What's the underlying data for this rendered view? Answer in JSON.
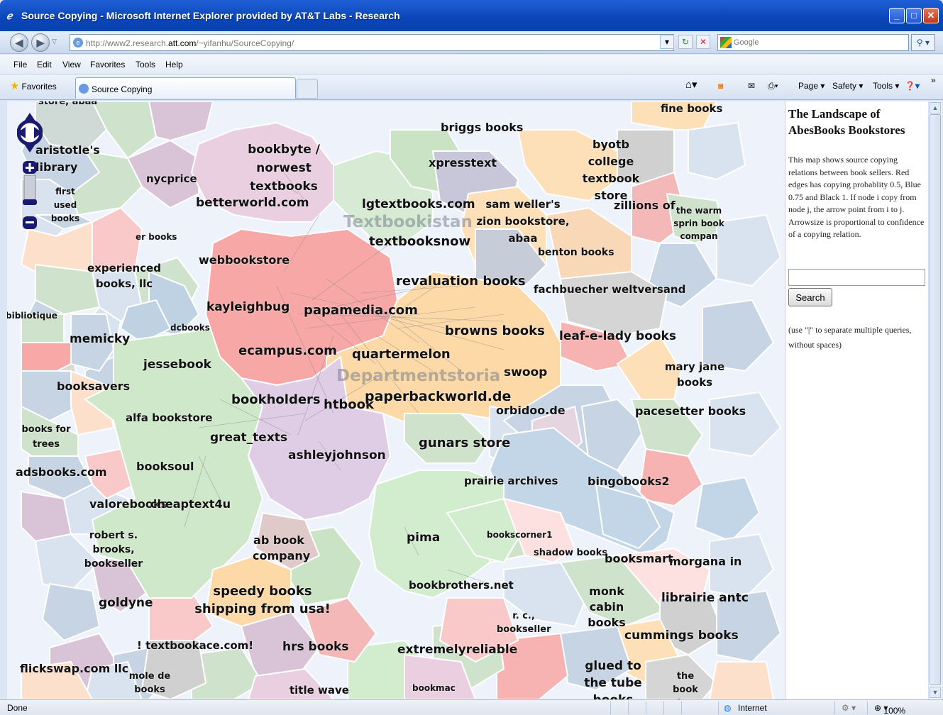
{
  "window": {
    "title": "Source Copying - Microsoft Internet Explorer provided by AT&T Labs - Research"
  },
  "nav": {
    "url_prefix": "http://www2.research.",
    "url_domain": "att.com",
    "url_rest": "/~yifanhu/SourceCopying/",
    "search_placeholder": "Google"
  },
  "menu": {
    "items": [
      "File",
      "Edit",
      "View",
      "Favorites",
      "Tools",
      "Help"
    ]
  },
  "favorites": {
    "favorites_label": "Favorites",
    "tab_label": "Source Copying"
  },
  "commandbar": {
    "page": "Page",
    "safety": "Safety",
    "tools": "Tools"
  },
  "panel": {
    "title": "The Landscape of AbesBooks Bookstores",
    "description": "This map shows source copying relations between book sellers. Red edges has copying probablity 0.5, Blue 0.75 and Black 1. If node i copy from node j, the arrow point from i to j. Arrowsize is proportional to confidence of a copying relation.",
    "search_value": "",
    "search_button": "Search",
    "hint": "(use \"|\" to separate multiple queries, without spaces)"
  },
  "status": {
    "left": "Done",
    "zone": "Internet",
    "zoom": "100%"
  },
  "map": {
    "regions": [
      {
        "name": "Textbookistan",
        "color": "#c9c9c9"
      },
      {
        "name": "Departmentstoria",
        "color": "#c9c9c9"
      }
    ],
    "labels": [
      "store, abaa",
      "fine books",
      "briggs books",
      "aristotle's library",
      "bookbyte / norwest textbooks",
      "byotb college textbook store",
      "xpresstext",
      "nycprice",
      "first used books",
      "betterworld.com",
      "lgtextbooks.com",
      "sam weller's zion bookstore, abaa",
      "zillions of",
      "the warm sprin book compan",
      "er books",
      "textbooksnow",
      "benton books",
      "webbookstore",
      "experienced books, llc",
      "revaluation books",
      "fachbuecher weltversand",
      "bibliotique",
      "kayleighbug",
      "papamedia.com",
      "dcbooks",
      "memicky",
      "browns books",
      "leaf-e-lady books",
      "ecampus.com",
      "quartermelon",
      "jessebook",
      "swoop",
      "mary jane books",
      "booksavers",
      "bookholders",
      "htbook",
      "paperbackworld.de",
      "orbidoo.de",
      "alfa bookstore",
      "pacesetter books",
      "books for trees",
      "great_texts",
      "gunars store",
      "ashleyjohnson",
      "adsbooks.com",
      "booksoul",
      "prairie archives",
      "bingobooks2",
      "valorebooks",
      "cheaptext4u",
      "robert s. brooks, bookseller",
      "ab book company",
      "pima",
      "bookscorner1",
      "shadow books",
      "booksmart",
      "morgana in",
      "speedy books shipping from usa!",
      "bookbrothers.net",
      "monk cabin books",
      "librairie antc",
      "goldyne",
      "r. c., bookseller",
      "cummings books",
      "! textbookace.com!",
      "hrs books",
      "extremelyreliable",
      "glued to the tube books",
      "flickswap.com llc",
      "mole de books",
      "the book store",
      "title wave",
      "bookmac"
    ]
  }
}
